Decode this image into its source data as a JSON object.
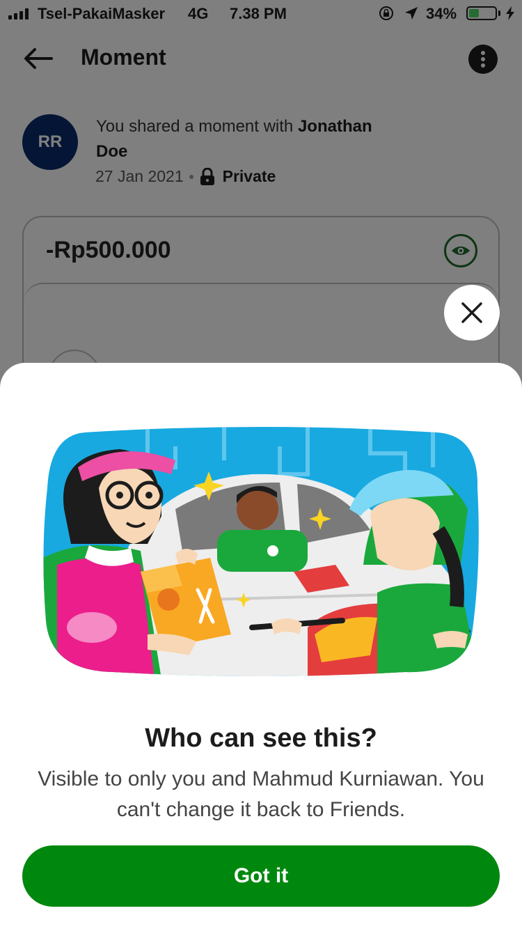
{
  "status_bar": {
    "carrier": "Tsel-PakaiMasker",
    "network": "4G",
    "time": "7.38 PM",
    "battery": "34%",
    "battery_level": 0.34
  },
  "header": {
    "title": "Moment",
    "back_icon": "arrow-left-icon",
    "menu_icon": "more-vertical-icon"
  },
  "share": {
    "avatar_initials": "RR",
    "text": "You shared a moment with ",
    "recipient": "Jonathan Doe",
    "date": "27 Jan 2021",
    "privacy": "Private",
    "privacy_icon": "lock-icon"
  },
  "moment": {
    "amount": "-Rp500.000",
    "visibility_icon": "eye-icon"
  },
  "sheet": {
    "close_icon": "close-icon",
    "title": "Who can see this?",
    "description": "Visible to only you and Mahmud Kurniawan. You can't change it back to Friends.",
    "button_label": "Got it"
  },
  "colors": {
    "brand_green": "#00880e",
    "avatar_blue": "#0b2a6b",
    "illustration_sky": "#18a9e0"
  }
}
